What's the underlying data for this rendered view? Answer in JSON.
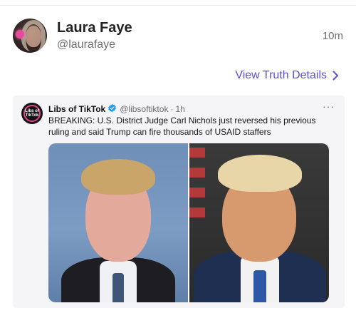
{
  "post": {
    "author": {
      "display_name": "Laura Faye",
      "handle": "@laurafaye"
    },
    "timestamp": "10m",
    "view_details_label": "View Truth Details"
  },
  "embedded_tweet": {
    "author_name": "Libs of TikTok",
    "author_handle": "@libsoftiktok",
    "separator": "·",
    "time": "1h",
    "more_label": "···",
    "avatar_text": "Libs of TikTok",
    "text": "BREAKING: U.S. District Judge Carl Nichols just reversed his previous ruling and said Trump can fire thousands of USAID staffers"
  },
  "colors": {
    "link": "#5b4fd6",
    "verified": "#1d9bf0",
    "card_background": "#f5f5f7"
  },
  "icons": {
    "details_chevron": "chevron-right-icon",
    "verified_badge": "verified-badge-icon"
  }
}
